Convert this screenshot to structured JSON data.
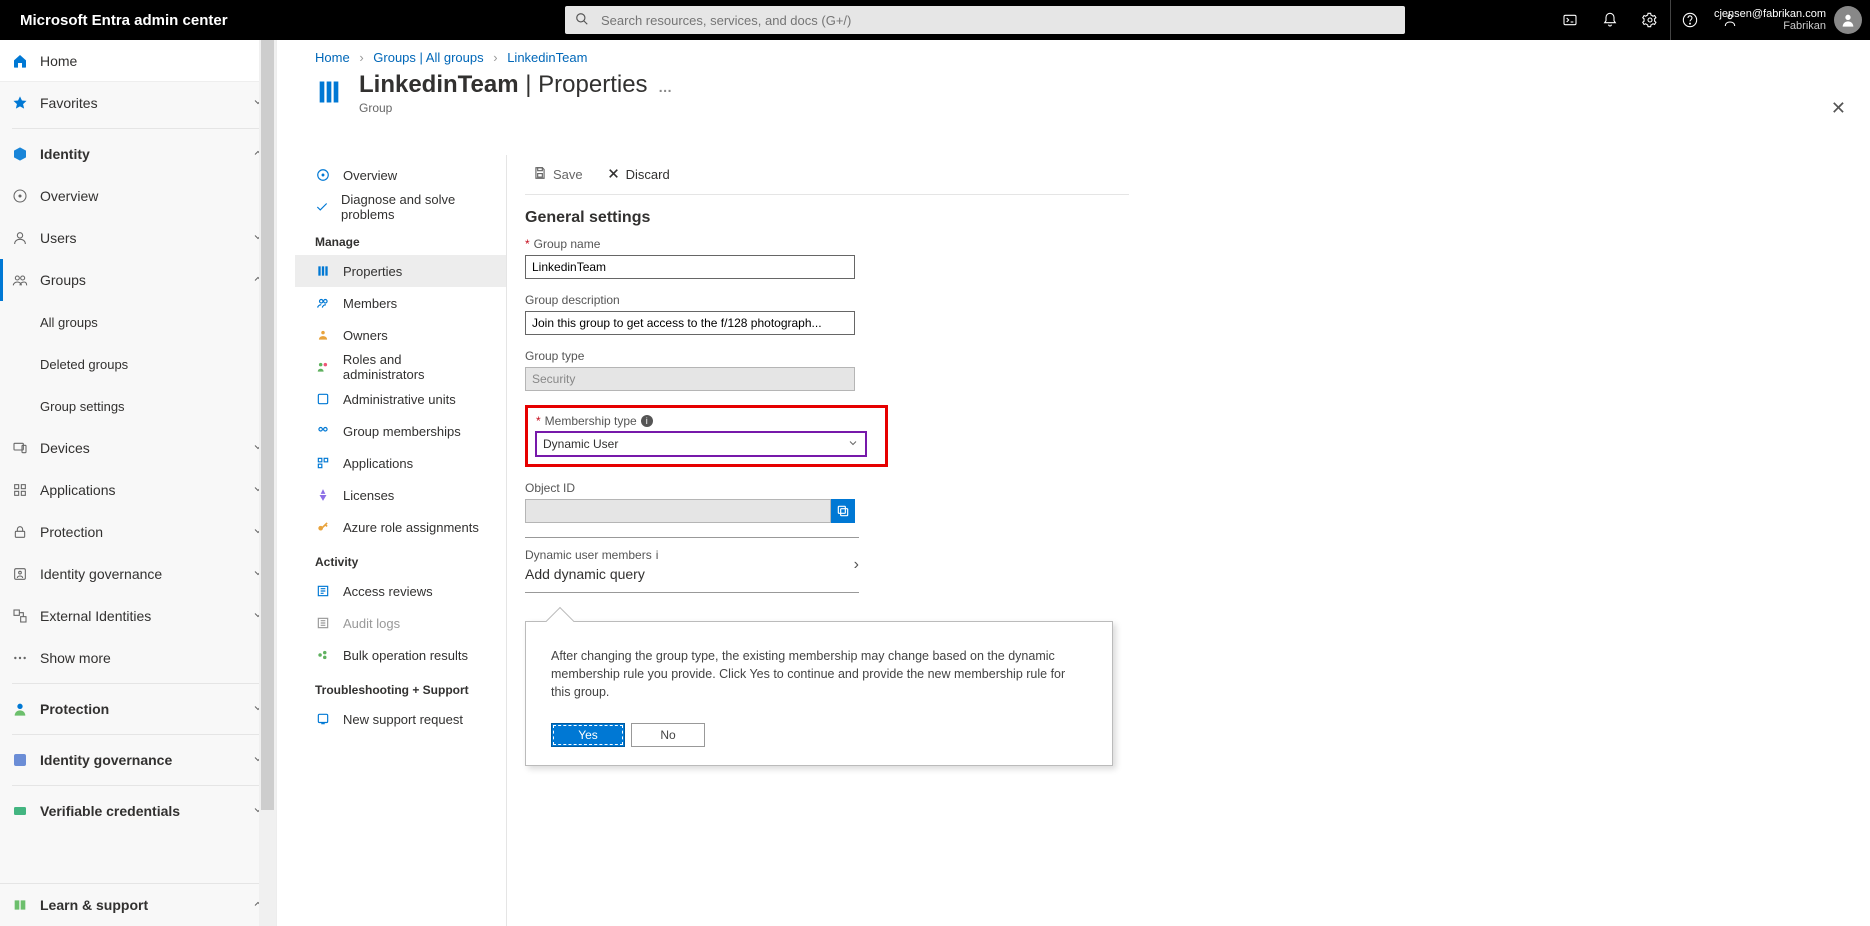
{
  "header": {
    "brand": "Microsoft Entra admin center",
    "search_placeholder": "Search resources, services, and docs (G+/)",
    "icons": [
      "cloud-shell",
      "notifications",
      "settings",
      "help",
      "feedback"
    ],
    "user": {
      "email": "cjensen@fabrikan.com",
      "tenant": "Fabrikan"
    }
  },
  "leftnav": {
    "home": "Home",
    "favorites": "Favorites",
    "section1": {
      "title": "Identity",
      "items": [
        "Overview",
        "Users",
        "Groups"
      ],
      "groups_children": [
        "All groups",
        "Deleted groups",
        "Group settings"
      ],
      "items2": [
        "Devices",
        "Applications",
        "Protection",
        "Identity governance",
        "External Identities",
        "Show more"
      ]
    },
    "sections": [
      "Protection",
      "Identity governance",
      "Verifiable credentials"
    ],
    "bottom": "Learn & support"
  },
  "breadcrumb": [
    "Home",
    "Groups | All groups",
    "LinkedinTeam"
  ],
  "page": {
    "title_a": "LinkedinTeam",
    "title_b": "Properties",
    "subtitle": "Group"
  },
  "blade": {
    "top": [
      "Overview",
      "Diagnose and solve problems"
    ],
    "manage_header": "Manage",
    "manage": [
      "Properties",
      "Members",
      "Owners",
      "Roles and administrators",
      "Administrative units",
      "Group memberships",
      "Applications",
      "Licenses",
      "Azure role assignments"
    ],
    "activity_header": "Activity",
    "activity": [
      "Access reviews",
      "Audit logs",
      "Bulk operation results"
    ],
    "trouble_header": "Troubleshooting + Support",
    "trouble": [
      "New support request"
    ]
  },
  "toolbar": {
    "save": "Save",
    "discard": "Discard"
  },
  "form": {
    "heading": "General settings",
    "group_name_label": "Group name",
    "group_name_value": "LinkedinTeam",
    "group_desc_label": "Group description",
    "group_desc_value": "Join this group to get access to the f/128 photograph...",
    "group_type_label": "Group type",
    "group_type_value": "Security",
    "membership_label": "Membership type",
    "membership_value": "Dynamic User",
    "objectid_label": "Object ID",
    "objectid_value": "",
    "dyn_label": "Dynamic user members",
    "dyn_action": "Add dynamic query"
  },
  "callout": {
    "text": "After changing the group type, the existing membership may change based on the dynamic membership rule you provide. Click Yes to continue and provide the new membership rule for this group.",
    "yes": "Yes",
    "no": "No"
  }
}
